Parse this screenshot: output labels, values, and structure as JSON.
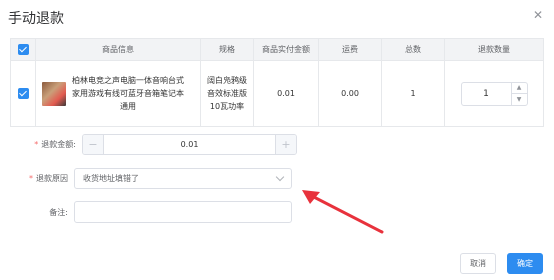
{
  "dialog": {
    "title": "手动退款"
  },
  "table": {
    "headers": [
      "",
      "商品信息",
      "规格",
      "商品实付金额",
      "运费",
      "总数",
      "退款数量"
    ],
    "row": {
      "checked": true,
      "product_name": "柏林电竞之声电脑一体音响台式家用游戏有线可蓝牙音箱笔记本通用",
      "spec": "阔白凫鸦级音效标准版10瓦功率",
      "paid_amount": "0.01",
      "shipping": "0.00",
      "total": "1",
      "refund_qty": "1"
    }
  },
  "form": {
    "amount_label": "退款金额:",
    "amount_value": "0.01",
    "amount_minus": "−",
    "amount_plus": "+",
    "reason_label": "退款原因",
    "reason_value": "收货地址填错了",
    "remark_label": "备注:"
  },
  "buttons": {
    "cancel": "取消",
    "confirm": "确定"
  },
  "colors": {
    "primary": "#2d8cf0",
    "required": "#f56c6c",
    "annotation_arrow": "#e8323c"
  }
}
